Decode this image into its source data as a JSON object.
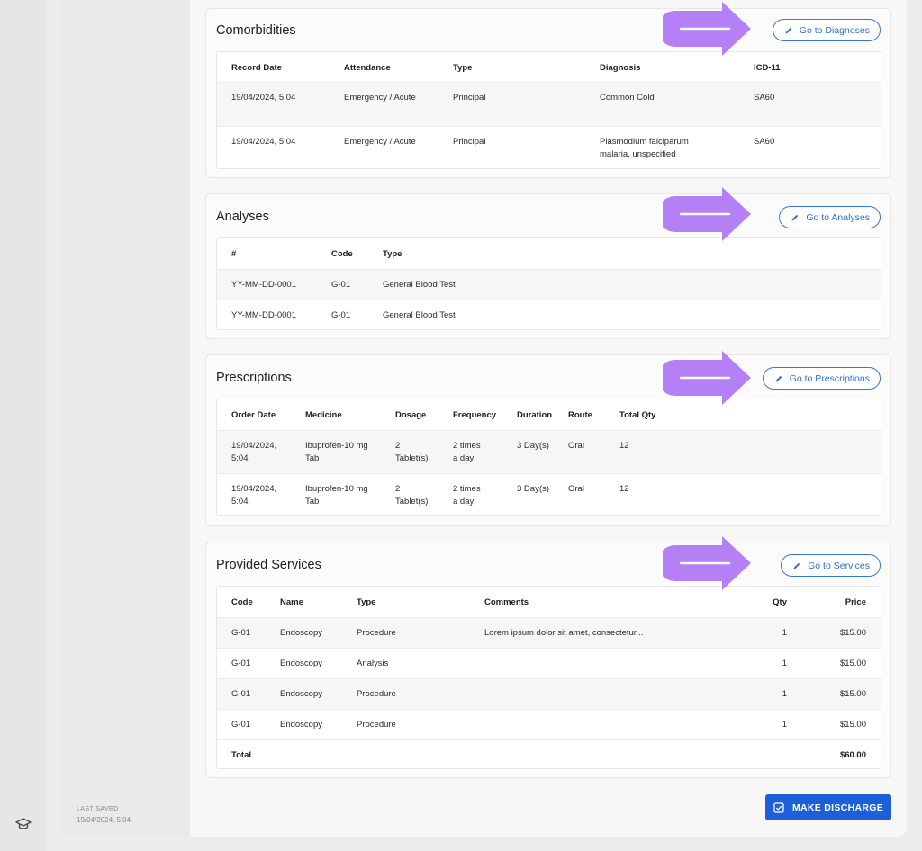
{
  "sidebar": {
    "last_saved_label": "LAST SAVED",
    "last_saved_value": "19/04/2024, 5:04",
    "bottom_icon": "graduation-cap-icon"
  },
  "comorbidities": {
    "title": "Comorbidities",
    "button_label": "Go to Diagnoses",
    "columns": [
      "Record Date",
      "Attendance",
      "Type",
      "Diagnosis",
      "ICD-11"
    ],
    "rows": [
      {
        "record_date": "19/04/2024, 5:04",
        "attendance": "Emergency / Acute",
        "type": "Principal",
        "diagnosis_line1": "Common Cold",
        "diagnosis_line2": "",
        "icd": "SA60"
      },
      {
        "record_date": "19/04/2024, 5:04",
        "attendance": "Emergency / Acute",
        "type": "Principal",
        "diagnosis_line1": "Plasmodium falciparum",
        "diagnosis_line2": "malaria, unspecified",
        "icd": "SA60"
      }
    ]
  },
  "analyses": {
    "title": "Analyses",
    "button_label": "Go to Analyses",
    "columns": [
      "#",
      "Code",
      "Type"
    ],
    "rows": [
      {
        "number": "YY-MM-DD-0001",
        "code": "G-01",
        "type": "General Blood Test"
      },
      {
        "number": "YY-MM-DD-0001",
        "code": "G-01",
        "type": "General Blood Test"
      }
    ]
  },
  "prescriptions": {
    "title": "Prescriptions",
    "button_label": "Go to Prescriptions",
    "columns": [
      "Order Date",
      "Medicine",
      "Dosage",
      "Frequency",
      "Duration",
      "Route",
      "Total Qty"
    ],
    "rows": [
      {
        "date1": "19/04/2024,",
        "date2": "5:04",
        "med1": "Ibuprofen-10 mg",
        "med2": "Tab",
        "dos1": "2",
        "dos2": "Tablet(s)",
        "freq1": "2 times",
        "freq2": "a day",
        "duration": "3 Day(s)",
        "route": "Oral",
        "qty": "12"
      },
      {
        "date1": "19/04/2024,",
        "date2": "5:04",
        "med1": "Ibuprofen-10 mg",
        "med2": "Tab",
        "dos1": "2",
        "dos2": "Tablet(s)",
        "freq1": "2 times",
        "freq2": "a day",
        "duration": "3 Day(s)",
        "route": "Oral",
        "qty": "12"
      }
    ]
  },
  "services": {
    "title": "Provided Services",
    "button_label": "Go to Services",
    "columns": [
      "Code",
      "Name",
      "Type",
      "Comments",
      "Qty",
      "Price"
    ],
    "rows": [
      {
        "code": "G-01",
        "name": "Endoscopy",
        "type": "Procedure",
        "comments": "Lorem ipsum dolor sit amet, consectetur...",
        "qty": "1",
        "price": "$15.00"
      },
      {
        "code": "G-01",
        "name": "Endoscopy",
        "type": "Analysis",
        "comments": "",
        "qty": "1",
        "price": "$15.00"
      },
      {
        "code": "G-01",
        "name": "Endoscopy",
        "type": "Procedure",
        "comments": "",
        "qty": "1",
        "price": "$15.00"
      },
      {
        "code": "G-01",
        "name": "Endoscopy",
        "type": "Procedure",
        "comments": "",
        "qty": "1",
        "price": "$15.00"
      }
    ],
    "total_label": "Total",
    "total_value": "$60.00"
  },
  "actions": {
    "discharge_label": "MAKE DISCHARGE"
  },
  "colors": {
    "accent": "#1d5fd8",
    "annotation_arrow": "#b57ff5"
  }
}
